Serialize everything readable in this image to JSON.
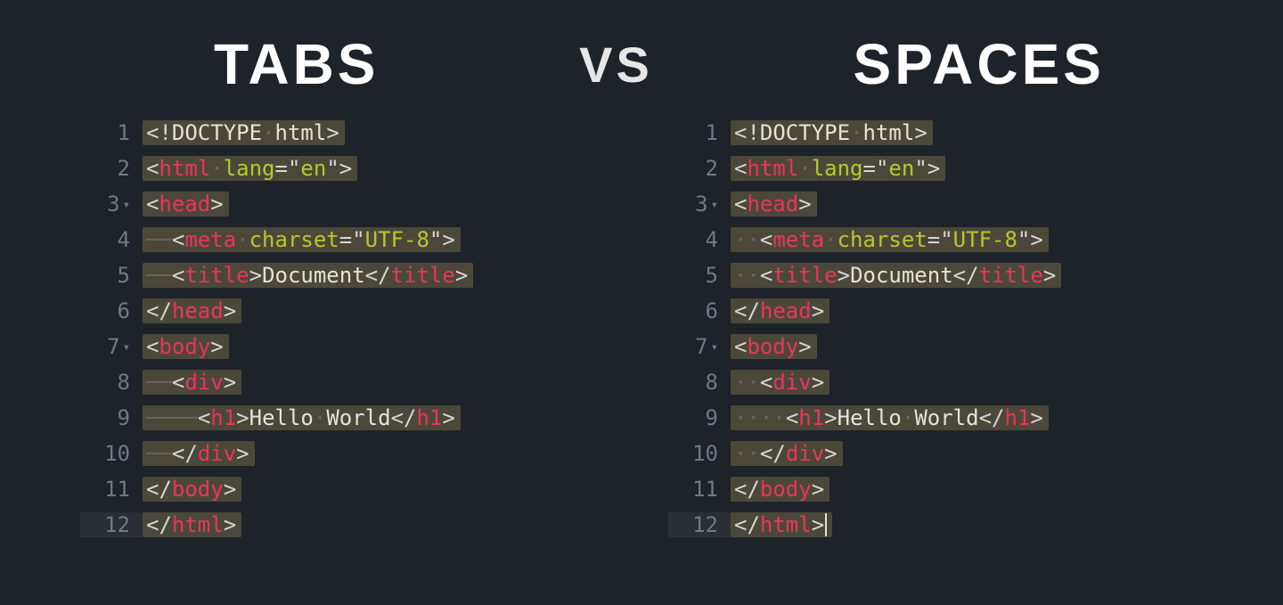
{
  "headings": {
    "left": "TABS",
    "mid": "VS",
    "right": "SPACES"
  },
  "left": {
    "style": "tabs",
    "lines": [
      {
        "num": "1",
        "indent": 0,
        "fold": false,
        "tokens": [
          [
            "br",
            "<!"
          ],
          [
            "txt",
            "DOCTYPE"
          ],
          [
            "br",
            "·"
          ],
          [
            "txt",
            "html"
          ],
          [
            "br",
            ">"
          ]
        ]
      },
      {
        "num": "2",
        "indent": 0,
        "fold": false,
        "tokens": [
          [
            "br",
            "<"
          ],
          [
            "tag",
            "html"
          ],
          [
            "br",
            "·"
          ],
          [
            "attr",
            "lang"
          ],
          [
            "br",
            "="
          ],
          [
            "br",
            "\""
          ],
          [
            "attr",
            "en"
          ],
          [
            "br",
            "\""
          ],
          [
            "br",
            ">"
          ]
        ]
      },
      {
        "num": "3",
        "indent": 0,
        "fold": true,
        "tokens": [
          [
            "br",
            "<"
          ],
          [
            "tag",
            "head"
          ],
          [
            "br",
            ">"
          ]
        ]
      },
      {
        "num": "4",
        "indent": 1,
        "fold": false,
        "tokens": [
          [
            "br",
            "<"
          ],
          [
            "tag",
            "meta"
          ],
          [
            "br",
            "·"
          ],
          [
            "attr",
            "charset"
          ],
          [
            "br",
            "="
          ],
          [
            "br",
            "\""
          ],
          [
            "attr",
            "UTF-8"
          ],
          [
            "br",
            "\""
          ],
          [
            "br",
            ">"
          ]
        ]
      },
      {
        "num": "5",
        "indent": 1,
        "fold": false,
        "tokens": [
          [
            "br",
            "<"
          ],
          [
            "tag",
            "title"
          ],
          [
            "br",
            ">"
          ],
          [
            "txt",
            "Document"
          ],
          [
            "br",
            "</"
          ],
          [
            "tag",
            "title"
          ],
          [
            "br",
            ">"
          ]
        ]
      },
      {
        "num": "6",
        "indent": 0,
        "fold": false,
        "tokens": [
          [
            "br",
            "</"
          ],
          [
            "tag",
            "head"
          ],
          [
            "br",
            ">"
          ]
        ]
      },
      {
        "num": "7",
        "indent": 0,
        "fold": true,
        "tokens": [
          [
            "br",
            "<"
          ],
          [
            "tag",
            "body"
          ],
          [
            "br",
            ">"
          ]
        ]
      },
      {
        "num": "8",
        "indent": 1,
        "fold": false,
        "tokens": [
          [
            "br",
            "<"
          ],
          [
            "tag",
            "div"
          ],
          [
            "br",
            ">"
          ]
        ]
      },
      {
        "num": "9",
        "indent": 2,
        "fold": false,
        "tokens": [
          [
            "br",
            "<"
          ],
          [
            "tag",
            "h1"
          ],
          [
            "br",
            ">"
          ],
          [
            "txt",
            "Hello"
          ],
          [
            "br",
            "·"
          ],
          [
            "txt",
            "World"
          ],
          [
            "br",
            "</"
          ],
          [
            "tag",
            "h1"
          ],
          [
            "br",
            ">"
          ]
        ]
      },
      {
        "num": "10",
        "indent": 1,
        "fold": false,
        "tokens": [
          [
            "br",
            "</"
          ],
          [
            "tag",
            "div"
          ],
          [
            "br",
            ">"
          ]
        ]
      },
      {
        "num": "11",
        "indent": 0,
        "fold": false,
        "tokens": [
          [
            "br",
            "</"
          ],
          [
            "tag",
            "body"
          ],
          [
            "br",
            ">"
          ]
        ]
      },
      {
        "num": "12",
        "indent": 0,
        "fold": false,
        "current": true,
        "tokens": [
          [
            "br",
            "</"
          ],
          [
            "tag",
            "html"
          ],
          [
            "br",
            ">"
          ]
        ]
      }
    ]
  },
  "right": {
    "style": "spaces",
    "lines": [
      {
        "num": "1",
        "indent": 0,
        "fold": false,
        "tokens": [
          [
            "br",
            "<!"
          ],
          [
            "txt",
            "DOCTYPE"
          ],
          [
            "br",
            "·"
          ],
          [
            "txt",
            "html"
          ],
          [
            "br",
            ">"
          ]
        ]
      },
      {
        "num": "2",
        "indent": 0,
        "fold": false,
        "tokens": [
          [
            "br",
            "<"
          ],
          [
            "tag",
            "html"
          ],
          [
            "br",
            "·"
          ],
          [
            "attr",
            "lang"
          ],
          [
            "br",
            "="
          ],
          [
            "br",
            "\""
          ],
          [
            "attr",
            "en"
          ],
          [
            "br",
            "\""
          ],
          [
            "br",
            ">"
          ]
        ]
      },
      {
        "num": "3",
        "indent": 0,
        "fold": true,
        "tokens": [
          [
            "br",
            "<"
          ],
          [
            "tag",
            "head"
          ],
          [
            "br",
            ">"
          ]
        ]
      },
      {
        "num": "4",
        "indent": 1,
        "fold": false,
        "tokens": [
          [
            "br",
            "<"
          ],
          [
            "tag",
            "meta"
          ],
          [
            "br",
            "·"
          ],
          [
            "attr",
            "charset"
          ],
          [
            "br",
            "="
          ],
          [
            "br",
            "\""
          ],
          [
            "attr",
            "UTF-8"
          ],
          [
            "br",
            "\""
          ],
          [
            "br",
            ">"
          ]
        ]
      },
      {
        "num": "5",
        "indent": 1,
        "fold": false,
        "tokens": [
          [
            "br",
            "<"
          ],
          [
            "tag",
            "title"
          ],
          [
            "br",
            ">"
          ],
          [
            "txt",
            "Document"
          ],
          [
            "br",
            "</"
          ],
          [
            "tag",
            "title"
          ],
          [
            "br",
            ">"
          ]
        ]
      },
      {
        "num": "6",
        "indent": 0,
        "fold": false,
        "tokens": [
          [
            "br",
            "</"
          ],
          [
            "tag",
            "head"
          ],
          [
            "br",
            ">"
          ]
        ]
      },
      {
        "num": "7",
        "indent": 0,
        "fold": true,
        "tokens": [
          [
            "br",
            "<"
          ],
          [
            "tag",
            "body"
          ],
          [
            "br",
            ">"
          ]
        ]
      },
      {
        "num": "8",
        "indent": 1,
        "fold": false,
        "tokens": [
          [
            "br",
            "<"
          ],
          [
            "tag",
            "div"
          ],
          [
            "br",
            ">"
          ]
        ]
      },
      {
        "num": "9",
        "indent": 2,
        "fold": false,
        "tokens": [
          [
            "br",
            "<"
          ],
          [
            "tag",
            "h1"
          ],
          [
            "br",
            ">"
          ],
          [
            "txt",
            "Hello"
          ],
          [
            "br",
            "·"
          ],
          [
            "txt",
            "World"
          ],
          [
            "br",
            "</"
          ],
          [
            "tag",
            "h1"
          ],
          [
            "br",
            ">"
          ]
        ]
      },
      {
        "num": "10",
        "indent": 1,
        "fold": false,
        "tokens": [
          [
            "br",
            "</"
          ],
          [
            "tag",
            "div"
          ],
          [
            "br",
            ">"
          ]
        ]
      },
      {
        "num": "11",
        "indent": 0,
        "fold": false,
        "tokens": [
          [
            "br",
            "</"
          ],
          [
            "tag",
            "body"
          ],
          [
            "br",
            ">"
          ]
        ]
      },
      {
        "num": "12",
        "indent": 0,
        "fold": false,
        "current": true,
        "cursor": true,
        "tokens": [
          [
            "br",
            "</"
          ],
          [
            "tag",
            "html"
          ],
          [
            "br",
            ">"
          ]
        ]
      }
    ]
  }
}
